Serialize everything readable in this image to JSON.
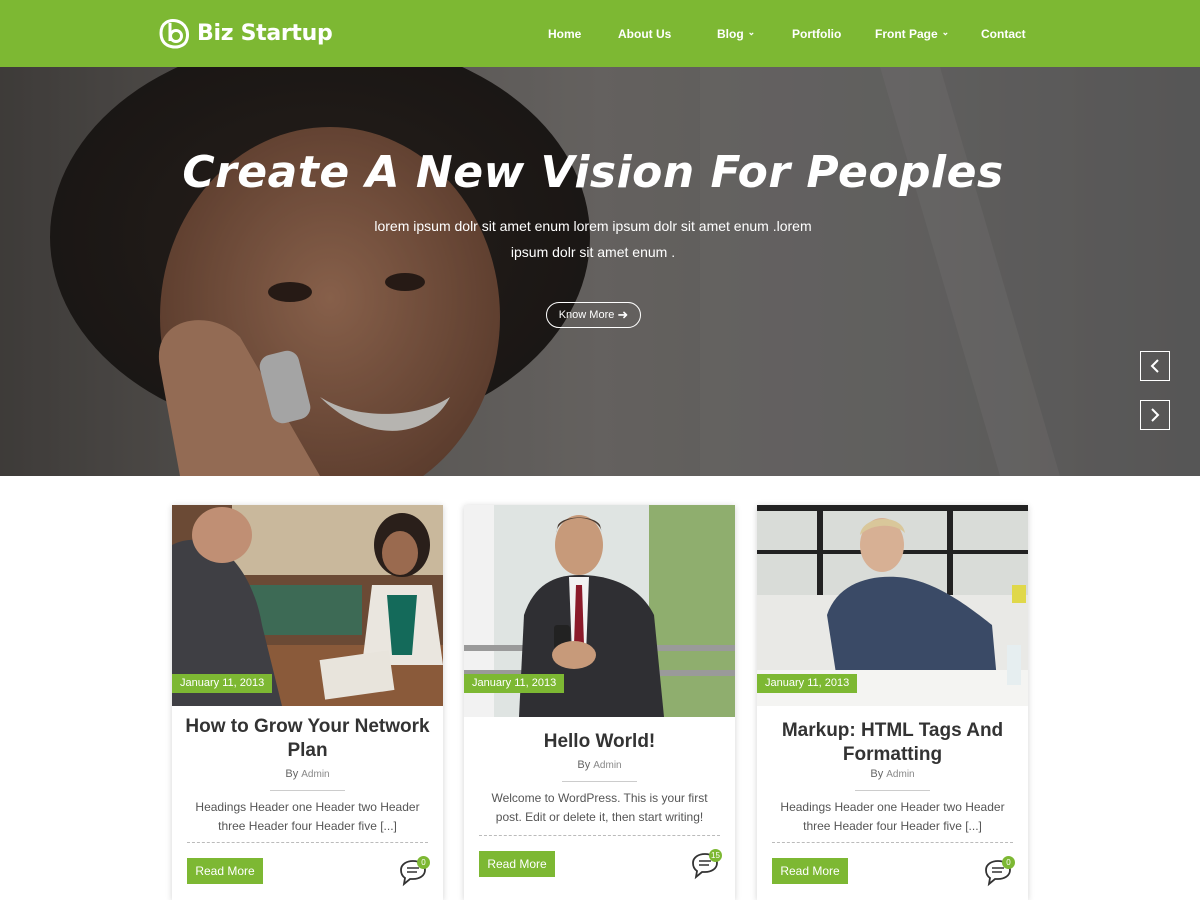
{
  "brand": {
    "name": "Biz Startup",
    "icon": "leaf-b-logo-icon"
  },
  "nav": [
    {
      "label": "Home",
      "dropdown": false
    },
    {
      "label": "About Us",
      "dropdown": false
    },
    {
      "label": "Blog",
      "dropdown": true
    },
    {
      "label": "Portfolio",
      "dropdown": false
    },
    {
      "label": "Front Page",
      "dropdown": true
    },
    {
      "label": "Contact",
      "dropdown": false
    }
  ],
  "hero": {
    "title": "Create A New Vision For Peoples",
    "subtitle": "lorem ipsum dolr sit amet enum lorem ipsum dolr sit amet enum .lorem ipsum dolr sit amet enum .",
    "button_label": "Know More",
    "prev_icon": "chevron-left-icon",
    "next_icon": "chevron-right-icon"
  },
  "posts": [
    {
      "date": "January 11, 2013",
      "title": "How to Grow Your Network Plan",
      "by": "By",
      "author": "Admin",
      "excerpt": "Headings Header one Header two Header three Header four Header five [...]",
      "read_more": "Read More",
      "comments": "0"
    },
    {
      "date": "January 11, 2013",
      "title": "Hello World!",
      "by": "By",
      "author": "Admin",
      "excerpt": "Welcome to WordPress. This is your first post. Edit or delete it, then start writing!",
      "read_more": "Read More",
      "comments": "15"
    },
    {
      "date": "January 11, 2013",
      "title": "Markup: HTML Tags And Formatting",
      "by": "By",
      "author": "Admin",
      "excerpt": "Headings Header one Header two Header three Header four Header five [...]",
      "read_more": "Read More",
      "comments": "0"
    }
  ],
  "colors": {
    "accent": "#7db833",
    "text": "#333333"
  }
}
